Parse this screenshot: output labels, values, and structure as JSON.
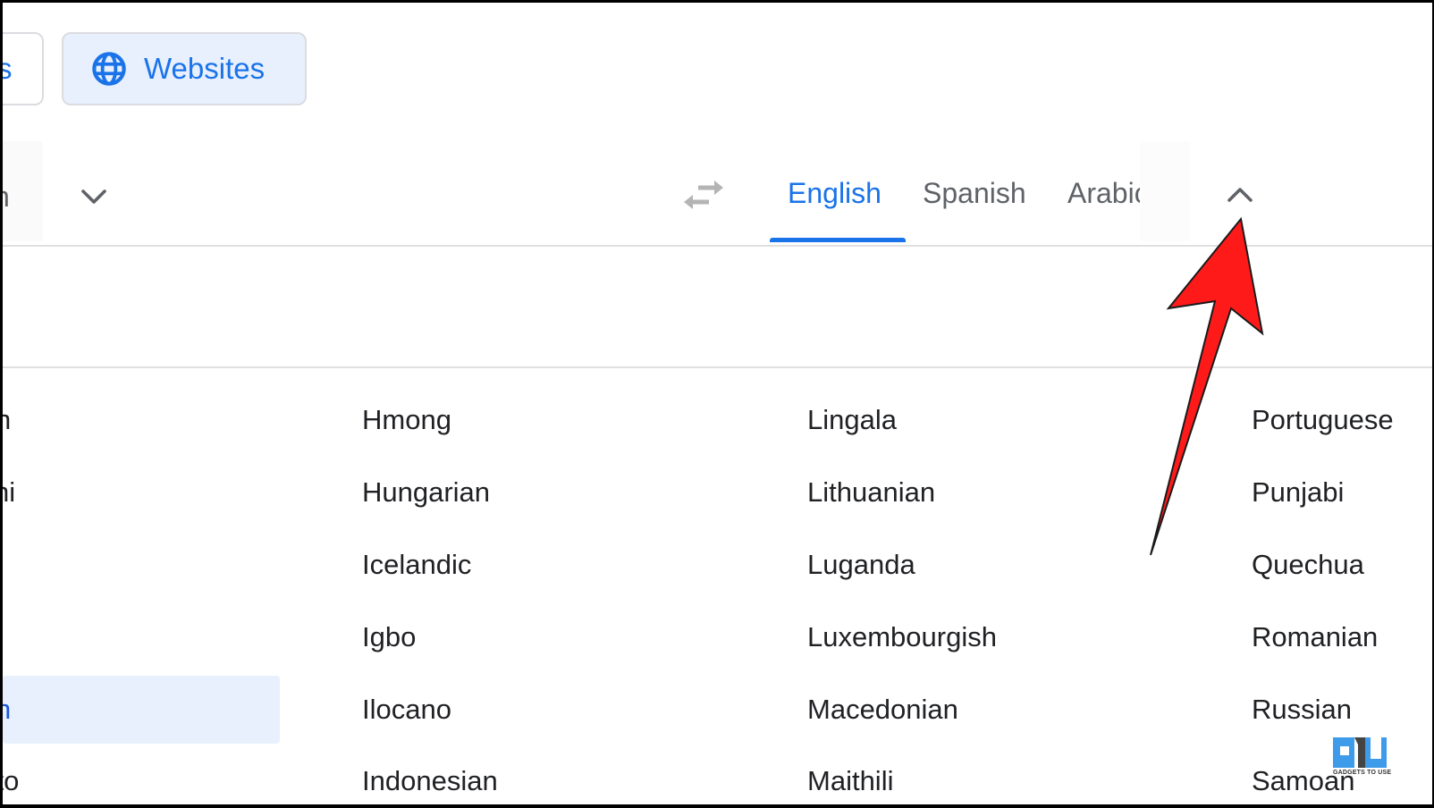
{
  "top_modes": {
    "prev_partial_label": "s",
    "websites_label": "Websites",
    "websites_icon": "globe-icon"
  },
  "language_bar": {
    "source_partial": "n",
    "source_dropdown_icon": "chevron-down-icon",
    "swap_icon": "swap-icon",
    "target_tabs": [
      {
        "label": "English",
        "active": true
      },
      {
        "label": "Spanish",
        "active": false
      },
      {
        "label": "Arabic",
        "active": false
      }
    ],
    "target_dropdown_icon": "chevron-up-icon"
  },
  "language_list": {
    "col0": [
      "n",
      "ni",
      "",
      "",
      "h",
      "anto"
    ],
    "col1": [
      "Hmong",
      "Hungarian",
      "Icelandic",
      "Igbo",
      "Ilocano",
      "Indonesian"
    ],
    "col2": [
      "Lingala",
      "Lithuanian",
      "Luganda",
      "Luxembourgish",
      "Macedonian",
      "Maithili"
    ],
    "col3": [
      "Portuguese",
      "Punjabi",
      "Quechua",
      "Romanian",
      "Russian",
      "Samoan"
    ],
    "selected_col0_index": 4
  },
  "annotation": {
    "arrow_color": "#ff1a1a"
  },
  "watermark": {
    "text": "GADGETS TO USE"
  },
  "colors": {
    "accent": "#1a73e8",
    "selected_bg": "#e8f0fe",
    "text": "#202124",
    "muted": "#5f6368"
  }
}
